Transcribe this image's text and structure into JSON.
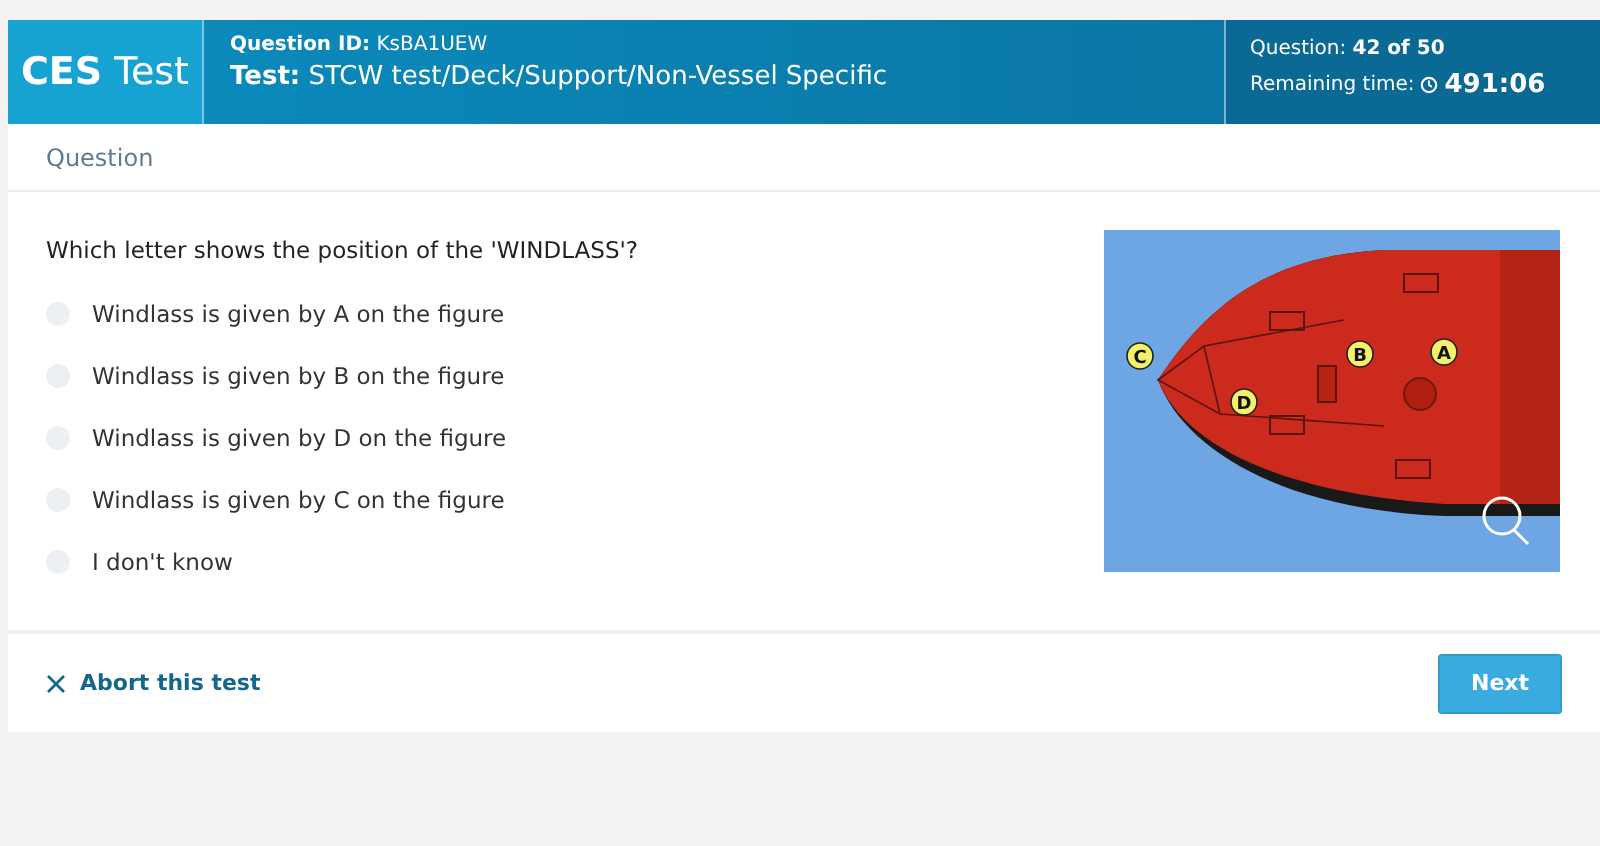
{
  "header": {
    "logo_bold": "CES",
    "logo_rest": "Test",
    "question_id": "**Question ID:** KsBA1UEW",
    "test": "**Test:** STCW test/Deck/Support/Non-Vessel Specific",
    "progress": "Question: **42 of 50**",
    "remaining_label": "Remaining time:",
    "remaining_value": "491:06"
  },
  "section_title": "Question",
  "question": "Which letter shows the position of the 'WINDLASS'?",
  "options": [
    {
      "label": "Windlass is given by A on the figure",
      "selected": false
    },
    {
      "label": "Windlass is given by B on the figure",
      "selected": false
    },
    {
      "label": "Windlass is given by D on the figure",
      "selected": false
    },
    {
      "label": "Windlass is given by C on the figure",
      "selected": false
    },
    {
      "label": "I don't know",
      "selected": false
    }
  ],
  "figure": {
    "labels": [
      "C",
      "B",
      "A",
      "D"
    ]
  },
  "footer": {
    "abort": "Abort this test",
    "next": "Next"
  }
}
